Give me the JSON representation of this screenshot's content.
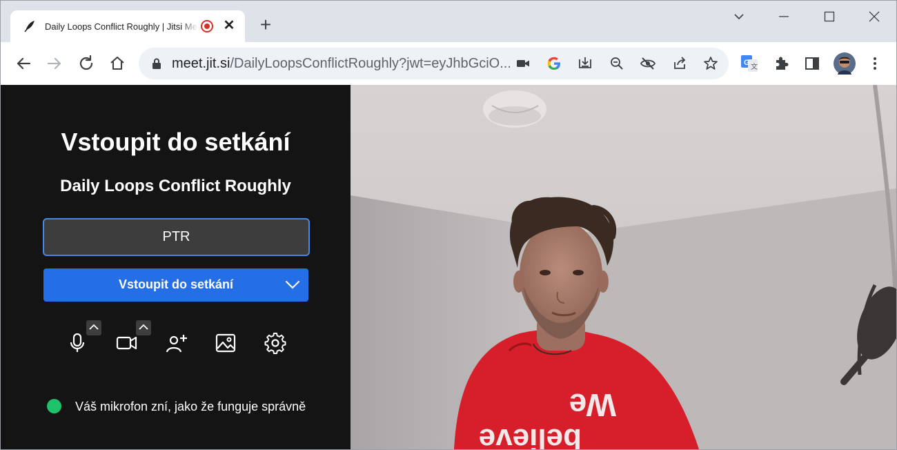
{
  "browser": {
    "tab": {
      "title": "Daily Loops Conflict Roughly | Jitsi Meet",
      "close_symbol": "✕"
    },
    "new_tab_symbol": "+",
    "window_controls": {
      "tabsearch": "⌵",
      "minimize": "—",
      "maximize": "☐",
      "close": "✕"
    },
    "address": {
      "host": "meet.jit.si",
      "path": "/DailyLoopsConflictRoughly?jwt=eyJhbGciO..."
    }
  },
  "prejoin": {
    "title": "Vstoupit do setkání",
    "room_name": "Daily Loops Conflict Roughly",
    "name_input": {
      "value": "PTR"
    },
    "join_button": {
      "label": "Vstoupit do setkání"
    },
    "mic_status": "Váš mikrofon zní, jako že funguje správně",
    "status_color": "#1ec26a"
  },
  "colors": {
    "accent": "#246fe5",
    "focus_border": "#4687ed",
    "panel_bg": "#141414"
  },
  "video": {
    "shirt_text_top": "We",
    "shirt_text_bottom": "believe"
  }
}
